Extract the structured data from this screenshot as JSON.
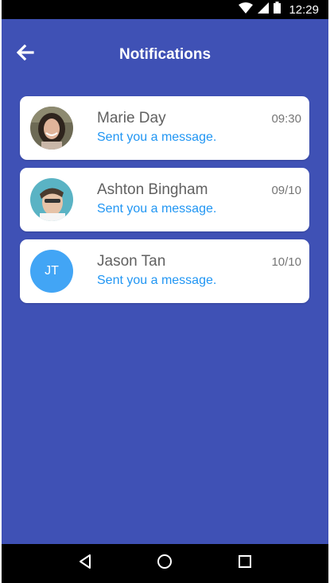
{
  "status_bar": {
    "time": "12:29",
    "icons": [
      "wifi-icon",
      "signal-icon",
      "battery-icon"
    ]
  },
  "header": {
    "title": "Notifications",
    "back_icon": "arrow-left-icon"
  },
  "notifications": [
    {
      "name": "Marie Day",
      "message": "Sent you a message.",
      "time": "09:30",
      "avatar": "photo"
    },
    {
      "name": "Ashton Bingham",
      "message": "Sent you a message.",
      "time": "09/10",
      "avatar": "photo"
    },
    {
      "name": "Jason Tan",
      "message": "Sent you a message.",
      "time": "10/10",
      "avatar": "initials",
      "initials": "JT"
    }
  ],
  "nav_bar": {
    "icons": [
      "back-triangle-icon",
      "home-circle-icon",
      "recents-square-icon"
    ]
  },
  "colors": {
    "background": "#3f51b5",
    "card": "#ffffff",
    "name_text": "#616161",
    "message_text": "#2196f3",
    "time_text": "#757575",
    "initials_avatar": "#42a5f5"
  }
}
